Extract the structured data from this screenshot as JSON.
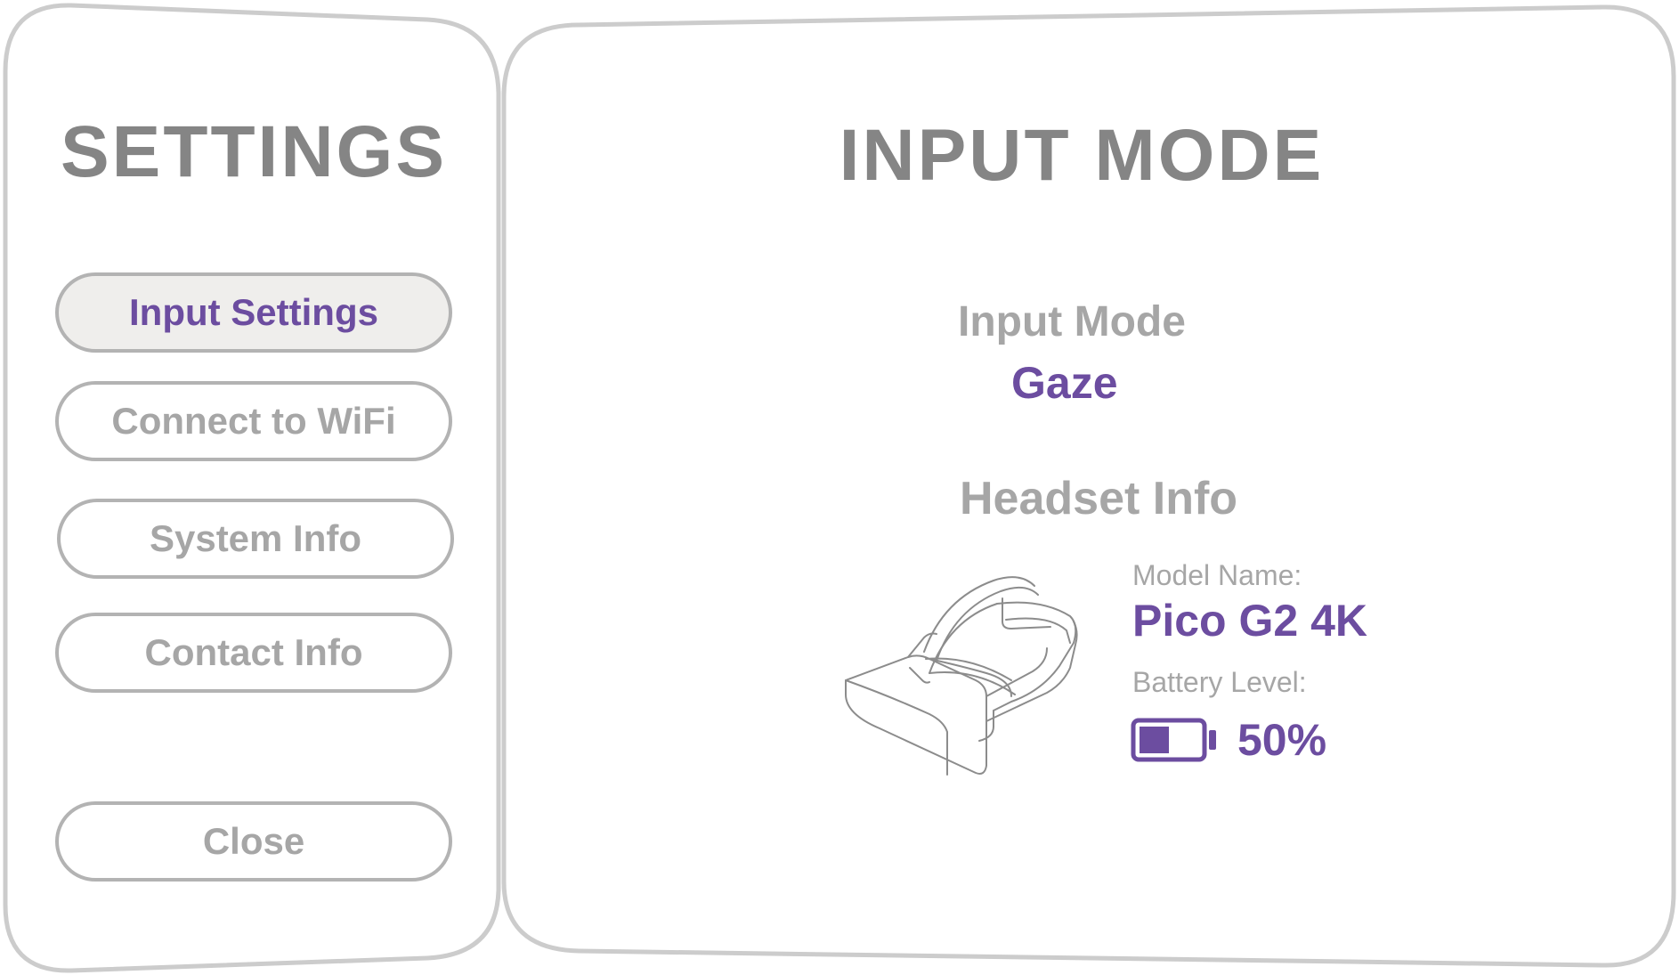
{
  "settings_panel": {
    "title": "SETTINGS",
    "menu": [
      {
        "label": "Input Settings",
        "active": true
      },
      {
        "label": "Connect to WiFi",
        "active": false
      },
      {
        "label": "System Info",
        "active": false
      },
      {
        "label": "Contact Info",
        "active": false
      }
    ],
    "close_label": "Close"
  },
  "input_panel": {
    "title": "INPUT MODE",
    "input_mode_label": "Input Mode",
    "input_mode_value": "Gaze",
    "headset_info_label": "Headset Info",
    "model_name_label": "Model Name:",
    "model_name_value": "Pico G2 4K",
    "battery_level_label": "Battery Level:",
    "battery_level_value": "50%",
    "battery_fill_fraction": 0.5,
    "headset_icon": "vr-headset-icon",
    "battery_icon": "battery-icon"
  },
  "colors": {
    "accent": "#6c4da0",
    "title_gray": "#858585",
    "label_gray": "#a6a6a6",
    "border_gray": "#cccccc",
    "active_button_bg": "#efeeec"
  }
}
